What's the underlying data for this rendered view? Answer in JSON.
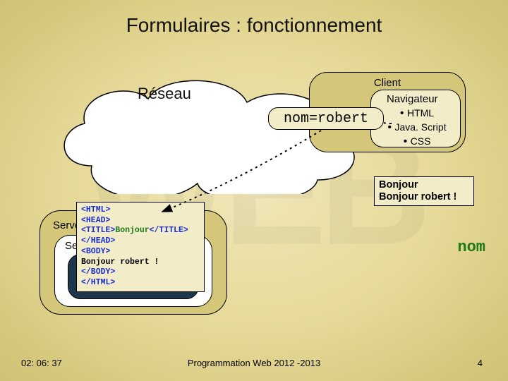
{
  "title": "Formulaires : fonctionnement",
  "network_label": "Réseau",
  "client": {
    "label": "Client",
    "navigator_title": "Navigateur",
    "items": [
      "HTML",
      "Java. Script",
      "CSS"
    ]
  },
  "query": "nom=robert",
  "result": {
    "line1": "Bonjour",
    "line2": "Bonjour robert !"
  },
  "server": {
    "outer_label": "Serve",
    "mid_label": "Ser"
  },
  "code": {
    "l1_open": "<HTML>",
    "l2_open": "<HEAD>",
    "l3_open": "<TITLE>",
    "l3_text": "Bonjour",
    "l3_close": "</TITLE>",
    "l4": "</HEAD>",
    "l5": "<BODY>",
    "l6": "Bonjour robert !",
    "l7": "</BODY>",
    "l8": "</HTML>"
  },
  "nom_label": "nom",
  "footer": {
    "time": "02: 06: 37",
    "center": "Programmation Web 2012 -2013",
    "page": "4"
  },
  "watermark": "WEB"
}
